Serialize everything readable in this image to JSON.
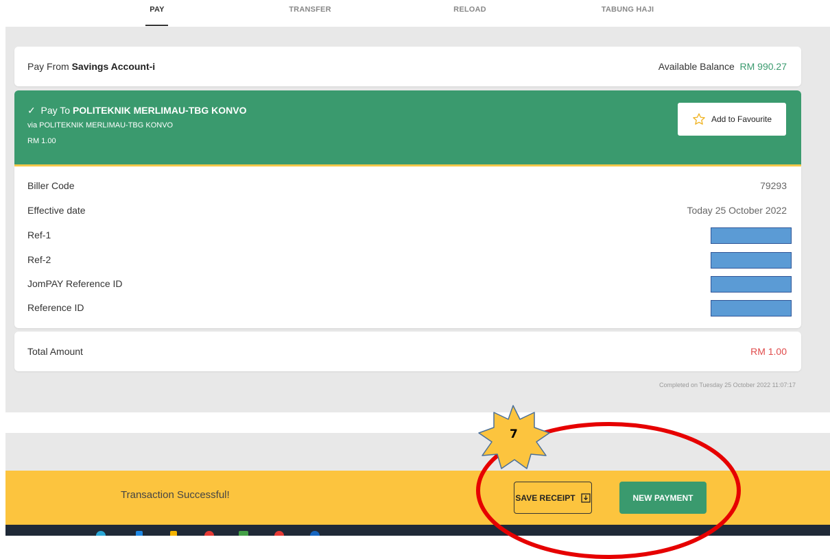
{
  "tabs": [
    {
      "label": "PAY",
      "active": true
    },
    {
      "label": "TRANSFER",
      "active": false
    },
    {
      "label": "RELOAD",
      "active": false
    },
    {
      "label": "TABUNG HAJI",
      "active": false
    }
  ],
  "pay_from": {
    "prefix": "Pay From",
    "account": "Savings Account-i",
    "balance_label": "Available Balance",
    "balance_value": "RM 990.27"
  },
  "pay_to": {
    "prefix": "Pay To",
    "name": "POLITEKNIK MERLIMAU-TBG KONVO",
    "via": "via POLITEKNIK MERLIMAU-TBG KONVO",
    "amount": "RM 1.00",
    "favourite_label": "Add to Favourite"
  },
  "details": [
    {
      "label": "Biller Code",
      "value": "79293"
    },
    {
      "label": "Effective date",
      "value": "Today 25 October 2022"
    },
    {
      "label": "Ref-1",
      "value": ""
    },
    {
      "label": "Ref-2",
      "value": ""
    },
    {
      "label": "JomPAY Reference ID",
      "value": ""
    },
    {
      "label": "Reference ID",
      "value": ""
    }
  ],
  "total": {
    "label": "Total Amount",
    "value": "RM 1.00"
  },
  "completed_text": "Completed on Tuesday 25 October 2022 11:07:17",
  "footer": {
    "status": "Transaction Successful!",
    "save_receipt": "SAVE RECEIPT",
    "new_payment": "NEW PAYMENT"
  },
  "annotation": {
    "step_number": "7"
  },
  "colors": {
    "green": "#3a9a6e",
    "yellow": "#fcc43e",
    "red_total": "#e04b4b",
    "annotation_red": "#e60000",
    "redaction_blue": "#5b9bd5"
  }
}
